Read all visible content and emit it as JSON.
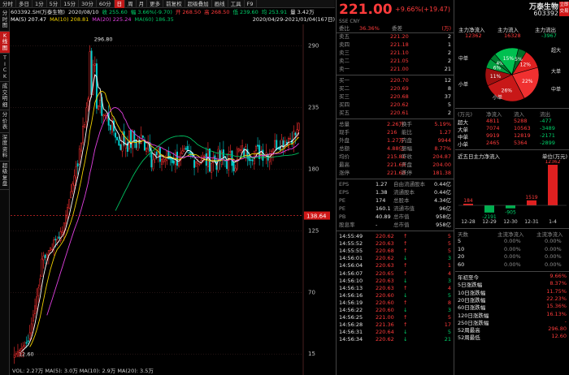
{
  "toolbar": {
    "items": [
      {
        "label": "分时",
        "active": false
      },
      {
        "label": "多日",
        "active": false
      },
      {
        "label": "1分",
        "active": false
      },
      {
        "label": "5分",
        "active": false
      },
      {
        "label": "15分",
        "active": false
      },
      {
        "label": "30分",
        "active": false
      },
      {
        "label": "60分",
        "active": false
      },
      {
        "label": "日",
        "active": true
      },
      {
        "label": "周",
        "active": false
      },
      {
        "label": "月",
        "active": false
      },
      {
        "label": "更多",
        "active": false
      },
      {
        "label": "前复权",
        "active": false
      },
      {
        "label": "超级叠加",
        "active": false
      },
      {
        "label": "画线",
        "active": false
      },
      {
        "label": "工具",
        "active": false
      },
      {
        "label": "F9",
        "active": false
      }
    ]
  },
  "side_tabs": [
    {
      "label": "分时图",
      "active": false
    },
    {
      "label": "K线图",
      "active": true
    },
    {
      "label": "TICK",
      "active": false
    },
    {
      "label": "成交明细",
      "active": false
    },
    {
      "label": "分价表",
      "active": false
    },
    {
      "label": "深度资料",
      "active": false
    },
    {
      "label": "超级复盘",
      "active": false
    }
  ],
  "chart_header": {
    "line1": [
      {
        "text": "603392.SH(万泰生物)",
        "cls": "white"
      },
      {
        "text": "2020/08/10",
        "cls": "white"
      },
      {
        "text": "收 255.60",
        "cls": "green"
      },
      {
        "text": "幅 3.66%(-9.70)",
        "cls": "green"
      },
      {
        "text": "开 268.50",
        "cls": "red"
      },
      {
        "text": "高 268.50",
        "cls": "red"
      },
      {
        "text": "低 239.60",
        "cls": "green"
      },
      {
        "text": "均 253.91",
        "cls": "green"
      },
      {
        "text": "量 3.42万",
        "cls": "white"
      }
    ],
    "line2": [
      {
        "text": "MA(5) 207.47",
        "color": "#ffffff"
      },
      {
        "text": "MA(10) 208.81",
        "color": "#f0d000"
      },
      {
        "text": "MA(20) 225.24",
        "color": "#e040e0"
      },
      {
        "text": "MA(60) 186.35",
        "color": "#00c060"
      }
    ],
    "date_range": "2020/04/29-2021/01/04(167日)"
  },
  "chart_data": {
    "type": "candlestick",
    "price_axis_labels": [
      "290",
      "235",
      "180",
      "125",
      "70",
      "15"
    ],
    "price_axis_values": [
      290,
      235,
      180,
      125,
      70,
      15
    ],
    "current_price_tag": "138.64",
    "current_price_value": 138.64,
    "max_label": "296.80",
    "max_value": 296.8,
    "min_label": "12.60",
    "min_value": 12.6,
    "ylim": [
      5,
      305
    ],
    "volume_label": "VOL: 2.27万  MA(5): 3.0万  MA(10): 2.9万  MA(20): 3.5万"
  },
  "quote": {
    "price": "221.00",
    "change": "+9.66%(+19.47)",
    "name": "万泰生物",
    "code": "603392",
    "badge": "立即\n交易",
    "currency": "SSE CNY",
    "wei_label": "委比",
    "wei_val": "36.36%",
    "wei_cha_label": "委差",
    "wei_cha_val": "(万)",
    "asks": [
      {
        "label": "卖五",
        "price": "221.20",
        "vol": "2"
      },
      {
        "label": "卖四",
        "price": "221.18",
        "vol": "1"
      },
      {
        "label": "卖三",
        "price": "221.10",
        "vol": "2"
      },
      {
        "label": "卖二",
        "price": "221.05",
        "vol": "2"
      },
      {
        "label": "卖一",
        "price": "221.00",
        "vol": "21"
      }
    ],
    "bids": [
      {
        "label": "买一",
        "price": "220.70",
        "vol": "12"
      },
      {
        "label": "买二",
        "price": "220.69",
        "vol": "8"
      },
      {
        "label": "买三",
        "price": "220.68",
        "vol": "37"
      },
      {
        "label": "买四",
        "price": "220.62",
        "vol": "5"
      },
      {
        "label": "买五",
        "price": "220.61",
        "vol": "2"
      }
    ],
    "stats": [
      {
        "k1": "总量",
        "v1": "2.26万",
        "k2": "换手",
        "v2": "5.19%"
      },
      {
        "k1": "现手",
        "v1": "216",
        "k2": "能比",
        "v2": "1.27"
      },
      {
        "k1": "外盘",
        "v1": "1.27万",
        "k2": "内盘",
        "v2": "9944"
      },
      {
        "k1": "总额",
        "v1": "4.88亿",
        "k2": "振幅",
        "v2": "8.77%"
      },
      {
        "k1": "均价",
        "v1": "215.81",
        "k2": "昨收",
        "v2": "204.87"
      },
      {
        "k1": "最高",
        "v1": "221.68",
        "k2": "开盘",
        "v2": "204.00"
      },
      {
        "k1": "涨停",
        "v1": "221.68",
        "k2": "跌停",
        "v2": "181.38"
      }
    ],
    "fundamentals": [
      {
        "k1": "EPS",
        "v1": "1.27",
        "k2": "自由流通股本",
        "v2": "0.44亿"
      },
      {
        "k1": "EPS",
        "v1": "1.38",
        "k2": "流通股本",
        "v2": "0.44亿"
      },
      {
        "k1": "PE",
        "v1": "174",
        "k2": "总股本",
        "v2": "4.34亿"
      },
      {
        "k1": "PE",
        "v1": "160.1",
        "k2": "流通市值",
        "v2": "96亿"
      },
      {
        "k1": "PB",
        "v1": "40.89",
        "k2": "总市值",
        "v2": "958亿"
      },
      {
        "k1": "股息率",
        "v1": "-",
        "k2": "总市值",
        "v2": "958亿"
      }
    ],
    "ticks": [
      {
        "time": "14:55:49",
        "price": "220.62",
        "vol": "5",
        "dir": "up"
      },
      {
        "time": "14:55:52",
        "price": "220.63",
        "vol": "5",
        "dir": "up"
      },
      {
        "time": "14:55:55",
        "price": "220.68",
        "vol": "5",
        "dir": "up"
      },
      {
        "time": "14:56:01",
        "price": "220.62",
        "vol": "3",
        "dir": "dn"
      },
      {
        "time": "14:56:04",
        "price": "220.63",
        "vol": "1",
        "dir": "up"
      },
      {
        "time": "14:56:07",
        "price": "220.65",
        "vol": "4",
        "dir": "up"
      },
      {
        "time": "14:56:10",
        "price": "220.63",
        "vol": "3",
        "dir": "dn"
      },
      {
        "time": "14:56:13",
        "price": "220.63",
        "vol": "4",
        "dir": "up"
      },
      {
        "time": "14:56:16",
        "price": "220.60",
        "vol": "5",
        "dir": "dn"
      },
      {
        "time": "14:56:19",
        "price": "220.60",
        "vol": "8",
        "dir": "up"
      },
      {
        "time": "14:56:22",
        "price": "220.60",
        "vol": "3",
        "dir": "dn"
      },
      {
        "time": "14:56:25",
        "price": "221.00",
        "vol": "5",
        "dir": "up"
      },
      {
        "time": "14:56:28",
        "price": "221.36",
        "vol": "17",
        "dir": "up"
      },
      {
        "time": "14:56:31",
        "price": "220.64",
        "vol": "5",
        "dir": "dn"
      },
      {
        "time": "14:56:34",
        "price": "220.62",
        "vol": "21",
        "dir": "dn"
      }
    ]
  },
  "fund_flow": {
    "hdr": [
      {
        "label": "主力净流入",
        "val": "12362",
        "cls": "red"
      },
      {
        "label": "主力流入",
        "val": "16328",
        "cls": "red"
      },
      {
        "label": "主力流出",
        "val": "-3967",
        "cls": "green"
      }
    ],
    "pie_labels": [
      {
        "text": "中单",
        "cls": "white"
      },
      {
        "text": "超大",
        "cls": "white"
      },
      {
        "text": "小单",
        "cls": "white"
      },
      {
        "text": "大单",
        "cls": "white"
      },
      {
        "text": "中单",
        "cls": "white"
      },
      {
        "text": "小单",
        "cls": "white"
      }
    ],
    "pie_slices": [
      {
        "label": "12%",
        "value": 12,
        "color": "#e02020"
      },
      {
        "label": "22%",
        "value": 22,
        "color": "#f03030"
      },
      {
        "label": "26%",
        "value": 26,
        "color": "#c81818"
      },
      {
        "label": "11%",
        "value": 11,
        "color": "#a01010"
      },
      {
        "label": "6%",
        "value": 6,
        "color": "#00a040"
      },
      {
        "label": "4%",
        "value": 4,
        "color": "#008030"
      },
      {
        "label": "15%",
        "value": 15,
        "color": "#00c050"
      },
      {
        "label": "5%",
        "value": 5,
        "color": "#007028"
      }
    ],
    "table_header": [
      "(万元)",
      "净流入",
      "流入",
      "流出"
    ],
    "table_rows": [
      {
        "name": "超大",
        "net": "4811",
        "in": "5288",
        "out": "-477"
      },
      {
        "name": "大单",
        "net": "7074",
        "in": "10563",
        "out": "-3489"
      },
      {
        "name": "中单",
        "net": "9919",
        "in": "12819",
        "out": "-2171"
      },
      {
        "name": "小单",
        "net": "2465",
        "in": "5364",
        "out": "-2899"
      }
    ],
    "recent_title": "近五日主力净流入",
    "unit_label": "单位(万元)",
    "bars": [
      {
        "date": "12-28",
        "value": 184,
        "label": "184"
      },
      {
        "date": "12-29",
        "value": -2191,
        "label": "-2191"
      },
      {
        "date": "12-30",
        "value": -905,
        "label": "-905"
      },
      {
        "date": "12-31",
        "value": 1519,
        "label": "1519"
      },
      {
        "date": "1-4",
        "value": 12362,
        "label": "12362"
      }
    ],
    "days_header": [
      "天数",
      "主流净流入",
      "主流净流入"
    ],
    "days_rows": [
      {
        "d": "5",
        "a": "0.00%",
        "b": "0.00%"
      },
      {
        "d": "10",
        "a": "0.00%",
        "b": "0.00%"
      },
      {
        "d": "20",
        "a": "0.00%",
        "b": "0.00%"
      },
      {
        "d": "60",
        "a": "0.00%",
        "b": "0.00%"
      }
    ],
    "perf_rows": [
      {
        "k": "年初至今",
        "v": "9.66%"
      },
      {
        "k": "5日涨跌幅",
        "v": "8.37%"
      },
      {
        "k": "10日涨跌幅",
        "v": "11.75%"
      },
      {
        "k": "20日涨跌幅",
        "v": "22.23%"
      },
      {
        "k": "60日涨跌幅",
        "v": "15.36%"
      },
      {
        "k": "120日涨跌幅",
        "v": "16.13%"
      },
      {
        "k": "250日涨跌幅",
        "v": "-"
      },
      {
        "k": "52周最高",
        "v": "296.80"
      },
      {
        "k": "52周最低",
        "v": "12.60"
      }
    ]
  }
}
